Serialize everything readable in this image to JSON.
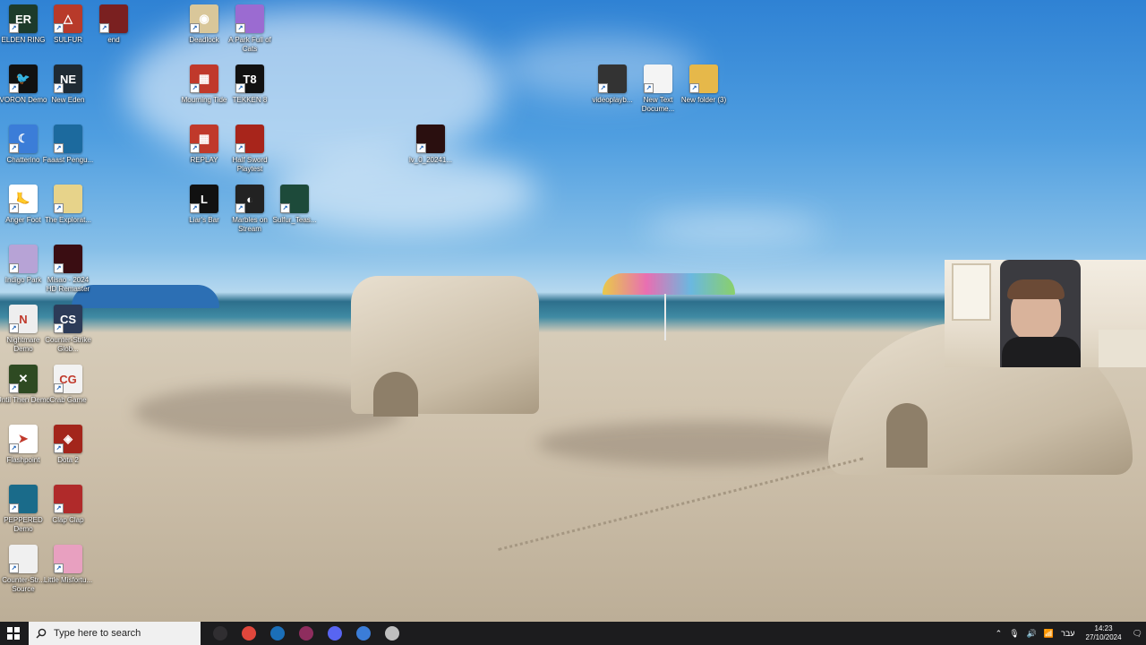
{
  "desktop_icons": [
    {
      "label": "ELDEN RING",
      "color": "#1d3b2b",
      "glyph": "ER"
    },
    {
      "label": "SULFUR",
      "color": "#b83a2a",
      "glyph": "△"
    },
    {
      "label": "end",
      "color": "#7a2020",
      "glyph": ""
    },
    {
      "label": "Deadlock",
      "color": "#d9c79a",
      "glyph": "◉"
    },
    {
      "label": "A Park Full of Cats",
      "color": "#9b6bd1",
      "glyph": ""
    },
    {
      "label": "VORON Demo",
      "color": "#111111",
      "glyph": "🐦"
    },
    {
      "label": "New Eden",
      "color": "#1f2a33",
      "glyph": "NE"
    },
    {
      "label": "Mourning Tide",
      "color": "#c0392b",
      "glyph": "▦"
    },
    {
      "label": "TEKKEN 8",
      "color": "#111111",
      "glyph": "T8"
    },
    {
      "label": "videoplayb...",
      "color": "#333333",
      "glyph": ""
    },
    {
      "label": "New Text Docume...",
      "color": "#f4f4f4",
      "glyph": ""
    },
    {
      "label": "New folder (3)",
      "color": "#e6b84a",
      "glyph": ""
    },
    {
      "label": "Chatterino",
      "color": "#3b7dd8",
      "glyph": "☾"
    },
    {
      "label": "Faaast Pengu...",
      "color": "#1c6a9e",
      "glyph": ""
    },
    {
      "label": "REPLAY",
      "color": "#c0392b",
      "glyph": "▦"
    },
    {
      "label": "Half Sword Playtest",
      "color": "#a8251b",
      "glyph": ""
    },
    {
      "label": "lv_0_20241...",
      "color": "#2a0f0f",
      "glyph": ""
    },
    {
      "label": "Anger Foot",
      "color": "#ffffff",
      "glyph": "🦶"
    },
    {
      "label": "The Explorat...",
      "color": "#e7d38a",
      "glyph": ""
    },
    {
      "label": "Liar's Bar",
      "color": "#111111",
      "glyph": "L"
    },
    {
      "label": "Marbles on Stream",
      "color": "#222222",
      "glyph": "◐"
    },
    {
      "label": "Sulfur_Teas...",
      "color": "#1d4a3a",
      "glyph": ""
    },
    {
      "label": "Indigo Park",
      "color": "#b7a3d6",
      "glyph": ""
    },
    {
      "label": "Misao - 2024 HD Remaster",
      "color": "#3a0d12",
      "glyph": ""
    },
    {
      "label": "Nightmare Demo",
      "color": "#eeeeee",
      "glyph": "N"
    },
    {
      "label": "Counter-Strike Glob...",
      "color": "#2c3b58",
      "glyph": "CS"
    },
    {
      "label": "Until Then Demo",
      "color": "#2e4a22",
      "glyph": "✕"
    },
    {
      "label": "Crab Game",
      "color": "#f2f2f2",
      "glyph": "CG"
    },
    {
      "label": "Flashpoint",
      "color": "#ffffff",
      "glyph": "➤"
    },
    {
      "label": "Dota 2",
      "color": "#a3251b",
      "glyph": "◈"
    },
    {
      "label": "PEPPERED Demo",
      "color": "#1a6b8a",
      "glyph": ""
    },
    {
      "label": "Clap Clap",
      "color": "#b02a2a",
      "glyph": ""
    },
    {
      "label": "Counter-Str... Source",
      "color": "#f0f0f0",
      "glyph": ""
    },
    {
      "label": "Little Misfortu...",
      "color": "#e8a0c0",
      "glyph": ""
    }
  ],
  "taskbar": {
    "search_placeholder": "Type here to search",
    "apps": [
      {
        "name": "obs",
        "color": "#302e31"
      },
      {
        "name": "chrome",
        "color": "#e0473c"
      },
      {
        "name": "steam",
        "color": "#1b6fb8"
      },
      {
        "name": "winrar",
        "color": "#8e2d5e"
      },
      {
        "name": "discord",
        "color": "#5865f2"
      },
      {
        "name": "chatterino",
        "color": "#3b7dd8"
      },
      {
        "name": "unknown",
        "color": "#bfbfbf"
      }
    ],
    "language": "עבר",
    "time": "14:23",
    "date": "27/10/2024"
  }
}
